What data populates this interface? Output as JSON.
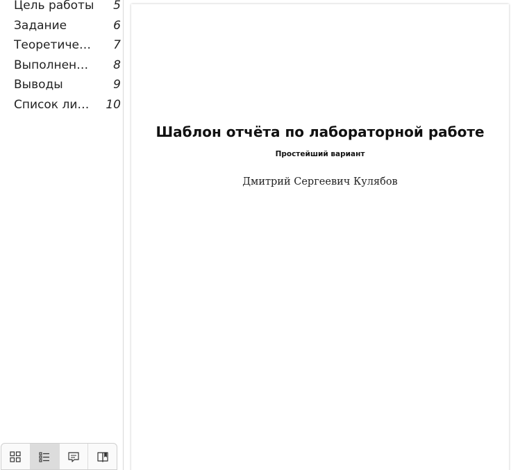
{
  "sidebar": {
    "outline": [
      {
        "label": "Цель работы",
        "page": "5"
      },
      {
        "label": "Задание",
        "page": "6"
      },
      {
        "label": "Теоретичес…",
        "page": "7"
      },
      {
        "label": "Выполнени…",
        "page": "8"
      },
      {
        "label": "Выводы",
        "page": "9"
      },
      {
        "label": "Список лит…",
        "page": "10"
      }
    ],
    "toolbar": [
      {
        "icon": "thumbnails-icon",
        "active": false
      },
      {
        "icon": "outline-icon",
        "active": true
      },
      {
        "icon": "annotations-icon",
        "active": false
      },
      {
        "icon": "bookmarks-icon",
        "active": false
      }
    ]
  },
  "document": {
    "title": "Шаблон отчёта по лабораторной работе",
    "subtitle": "Простейший вариант",
    "author": "Дмитрий Сергеевич Кулябов"
  }
}
